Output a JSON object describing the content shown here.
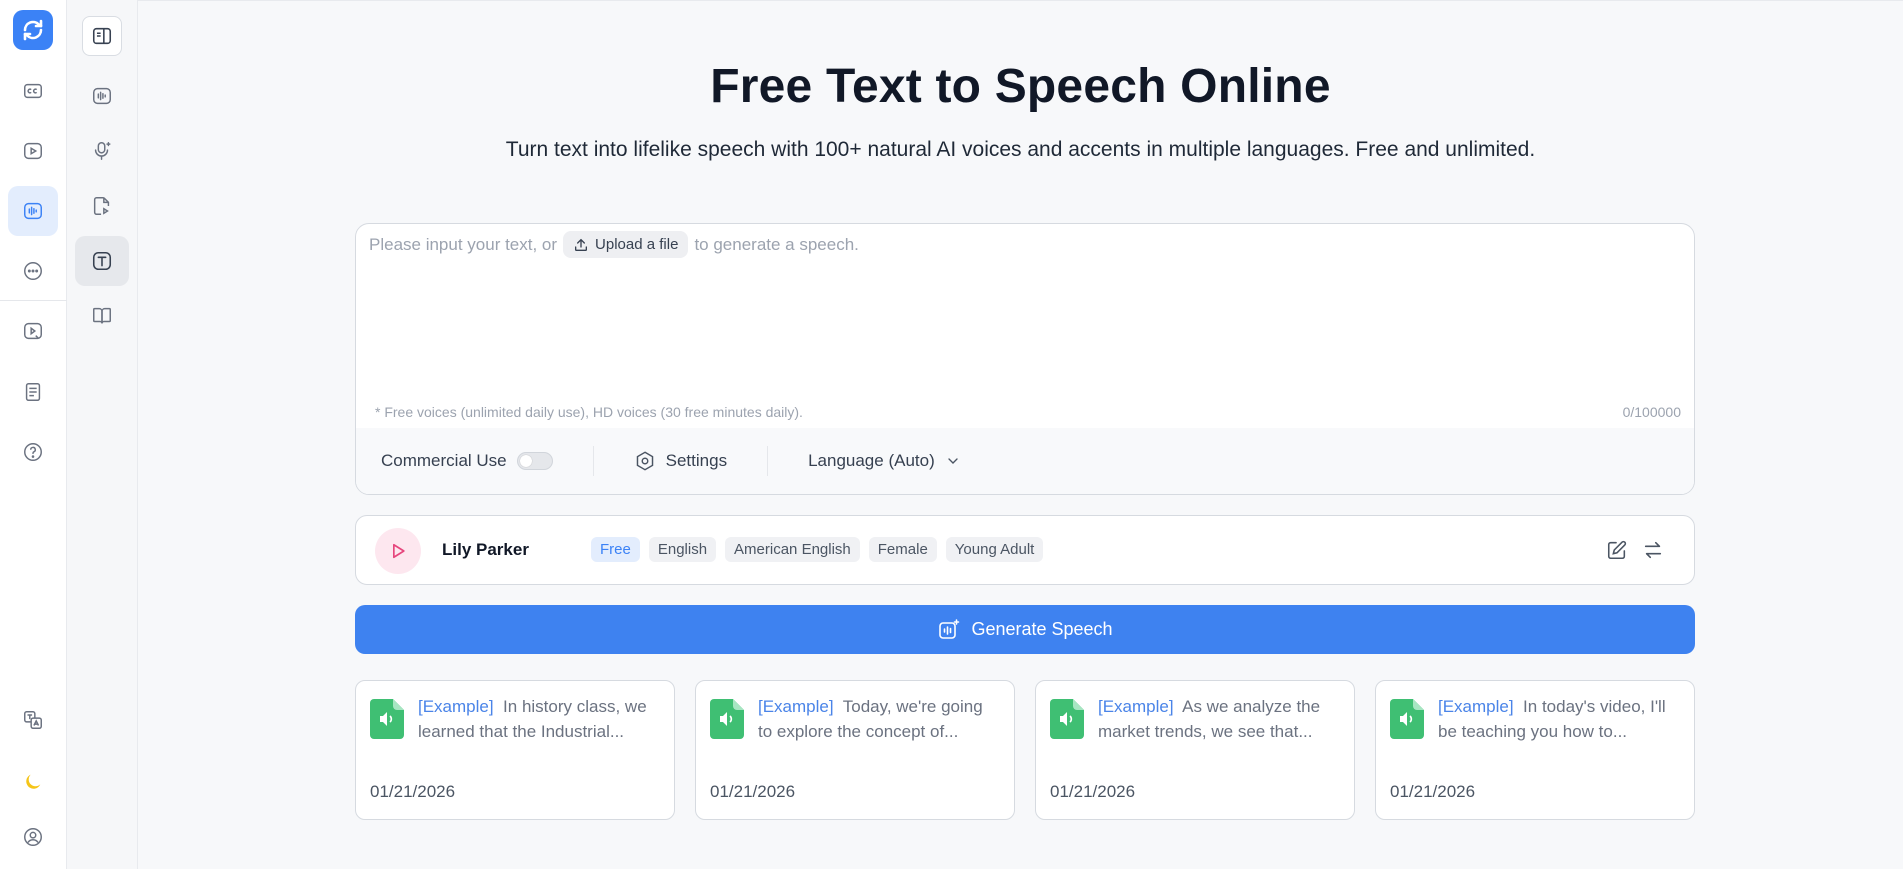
{
  "main": {
    "title": "Free Text to Speech Online",
    "subtitle": "Turn text into lifelike speech with 100+ natural AI voices and accents in multiple languages. Free and unlimited."
  },
  "editor": {
    "placeholder_before": "Please input your text, or",
    "upload_label": "Upload a file",
    "placeholder_after": "to generate a speech.",
    "note": "* Free voices (unlimited daily use), HD voices (30 free minutes daily).",
    "count": "0/100000",
    "commercial_label": "Commercial Use",
    "commercial_enabled": false,
    "settings_label": "Settings",
    "language_label": "Language (Auto)"
  },
  "voice": {
    "name": "Lily Parker",
    "tags": [
      "Free",
      "English",
      "American English",
      "Female",
      "Young Adult"
    ]
  },
  "generate_label": "Generate Speech",
  "examples": [
    {
      "tag": "[Example]",
      "text": "In history class, we learned that the Industrial...",
      "date": "01/21/2026"
    },
    {
      "tag": "[Example]",
      "text": "Today, we're going to explore the concept of...",
      "date": "01/21/2026"
    },
    {
      "tag": "[Example]",
      "text": "As we analyze the market trends, we see that...",
      "date": "01/21/2026"
    },
    {
      "tag": "[Example]",
      "text": "In today's video, I'll be teaching you how to...",
      "date": "01/21/2026"
    }
  ],
  "colors": {
    "accent": "#3e82f0",
    "active_rail": "#e3edfd",
    "play_bg": "#fde7ef",
    "file_icon": "#3fbf73",
    "moon": "#f5c518"
  },
  "icons": {
    "rail": [
      "logo-icon",
      "captions-icon",
      "video-icon",
      "audio-wave-icon",
      "more-icon",
      "video-edit-icon",
      "document-icon",
      "help-icon",
      "translate-icon",
      "moon-icon",
      "user-icon"
    ],
    "rail2": [
      "sidebar-toggle-icon",
      "audio-wave-icon",
      "mic-sparkle-icon",
      "file-audio-icon",
      "text-icon",
      "book-icon"
    ]
  }
}
